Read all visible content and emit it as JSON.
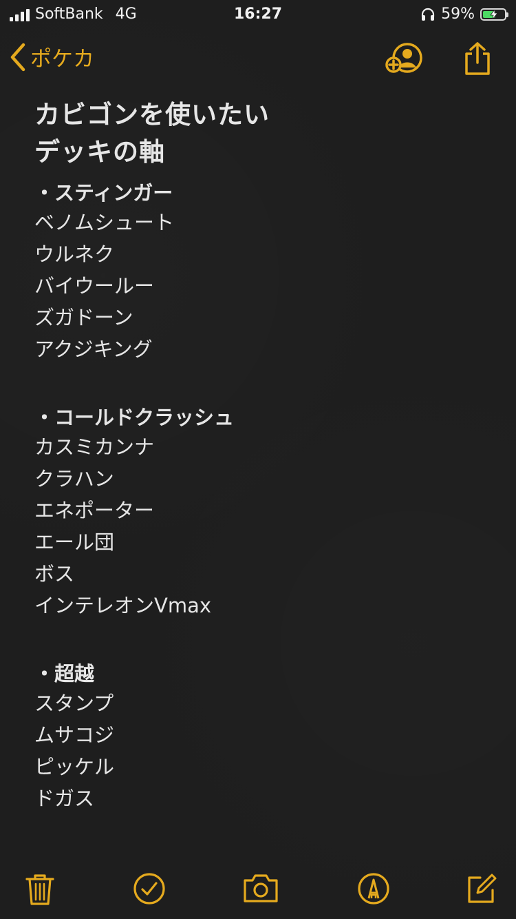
{
  "status_bar": {
    "carrier": "SoftBank",
    "network": "4G",
    "time": "16:27",
    "battery_percent": "59%",
    "battery_level": 0.59,
    "battery_color": "#4cd964",
    "icons": [
      "signal-icon",
      "headphones-icon",
      "battery-icon"
    ]
  },
  "nav": {
    "back_label": "ポケカ",
    "accent": "#e5aa1e",
    "icons": [
      "chevron-left-icon",
      "add-person-icon",
      "share-icon"
    ]
  },
  "note": {
    "title_line1": "カビゴンを使いたい",
    "title_line2": "デッキの軸",
    "sections": [
      {
        "heading": "・スティンガー",
        "items": [
          "ベノムシュート",
          "ウルネク",
          "バイウールー",
          "ズガドーン",
          "アクジキング"
        ]
      },
      {
        "heading": "・コールドクラッシュ",
        "items": [
          "カスミカンナ",
          "クラハン",
          "エネポーター",
          "エール団",
          "ボス",
          "インテレオンVmax"
        ]
      },
      {
        "heading": "・超越",
        "items": [
          "スタンプ",
          "ムサコジ",
          "ピッケル",
          "ドガス"
        ]
      }
    ]
  },
  "toolbar": {
    "icons": [
      "trash-icon",
      "checklist-icon",
      "camera-icon",
      "markup-icon",
      "compose-icon"
    ]
  }
}
